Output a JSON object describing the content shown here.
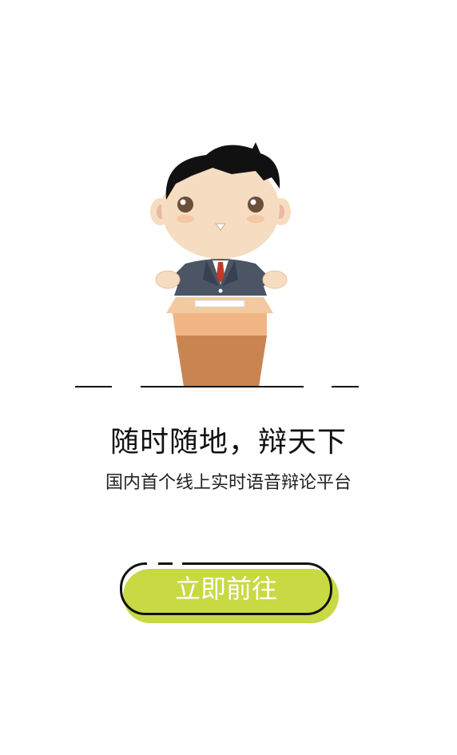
{
  "hero": {
    "illustration_icon": "debater-at-podium-icon",
    "title": "随时随地，辩天下",
    "subtitle": "国内首个线上实时语音辩论平台"
  },
  "cta": {
    "label": "立即前往",
    "accent_color": "#c8d944",
    "outline_color": "#111111"
  }
}
